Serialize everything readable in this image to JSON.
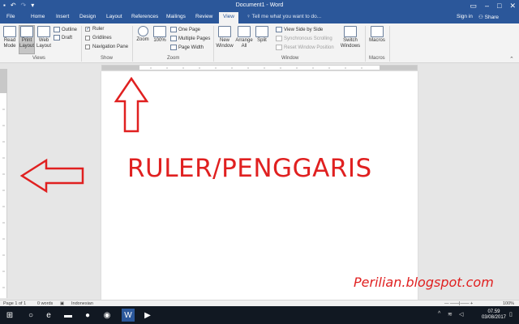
{
  "titlebar": {
    "title": "Document1 - Word",
    "sign_in": "Sign in",
    "share": "Share"
  },
  "tabs": [
    "File",
    "Home",
    "Insert",
    "Design",
    "Layout",
    "References",
    "Mailings",
    "Review",
    "View"
  ],
  "active_tab": "View",
  "tell_me": "Tell me what you want to do...",
  "ribbon": {
    "views": {
      "label": "Views",
      "read_mode": "Read Mode",
      "print_layout": "Print Layout",
      "web_layout": "Web Layout",
      "outline": "Outline",
      "draft": "Draft"
    },
    "show": {
      "label": "Show",
      "ruler": "Ruler",
      "gridlines": "Gridlines",
      "navigation_pane": "Navigation Pane"
    },
    "zoom": {
      "label": "Zoom",
      "zoom": "Zoom",
      "hundred": "100%",
      "one_page": "One Page",
      "multiple_pages": "Multiple Pages",
      "page_width": "Page Width"
    },
    "window": {
      "label": "Window",
      "new_window": "New Window",
      "arrange_all": "Arrange All",
      "split": "Split",
      "view_side_by_side": "View Side by Side",
      "synchronous_scrolling": "Synchronous Scrolling",
      "reset_window_position": "Reset Window Position",
      "switch_windows": "Switch Windows"
    },
    "macros": {
      "label": "Macros",
      "macros": "Macros"
    }
  },
  "document": {
    "annotation_text": "RULER/PENGGARIS",
    "watermark": "Perilian.blogspot.com",
    "annotation_color": "#e02020"
  },
  "statusbar": {
    "page": "Page 1 of 1",
    "words": "0 words",
    "language": "Indonesian",
    "zoom": "100%"
  },
  "taskbar": {
    "time": "07.59",
    "date": "03/08/2017"
  },
  "colors": {
    "word_blue": "#2b579a",
    "taskbar": "#111822"
  }
}
